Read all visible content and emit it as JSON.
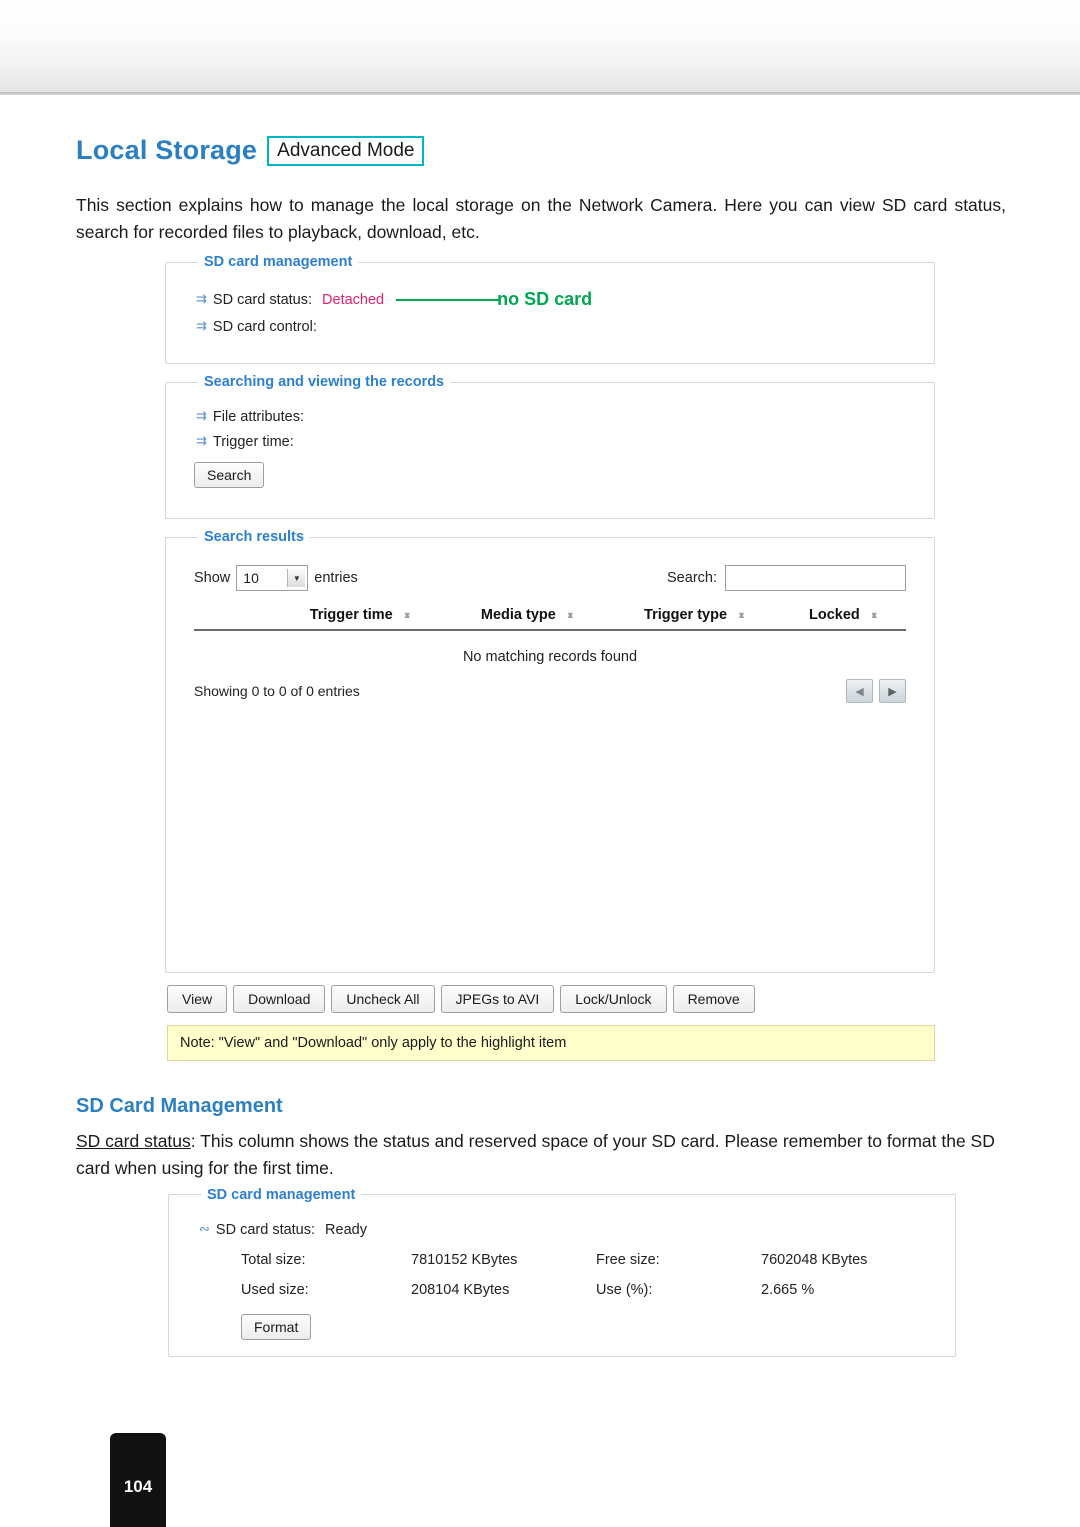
{
  "heading": {
    "title": "Local Storage",
    "badge": "Advanced Mode"
  },
  "intro": "This section explains how to manage the local storage on the Network Camera. Here you can view SD card status, search for recorded files to playback, download, etc.",
  "screenshot1": {
    "sd_management": {
      "legend": "SD card management",
      "status_label": "SD card status:",
      "status_value": "Detached",
      "callout": "no SD card",
      "control_label": "SD card control:"
    },
    "searching": {
      "legend": "Searching and viewing the records",
      "file_attributes_label": "File attributes:",
      "trigger_time_label": "Trigger time:",
      "search_button": "Search"
    },
    "results": {
      "legend": "Search results",
      "show_label": "Show",
      "show_value": "10",
      "entries_label": "entries",
      "search_label": "Search:",
      "search_value": "",
      "columns": [
        "",
        "Trigger time",
        "Media type",
        "Trigger type",
        "Locked"
      ],
      "empty_message": "No matching records found",
      "showing_text": "Showing 0 to 0 of 0 entries",
      "prev_icon": "prev-arrow-icon",
      "next_icon": "next-arrow-icon"
    },
    "buttons": [
      "View",
      "Download",
      "Uncheck All",
      "JPEGs to AVI",
      "Lock/Unlock",
      "Remove"
    ],
    "note": "Note: \"View\" and \"Download\" only apply to the highlight item"
  },
  "section2": {
    "heading": "SD Card Management",
    "para_underlined": "SD card status",
    "para_rest": ": This column shows the status and reserved space of your SD card. Please remember to format the SD card when using for the first time."
  },
  "screenshot2": {
    "legend": "SD card management",
    "status_label": "SD card status:",
    "status_value": "Ready",
    "fields": [
      {
        "label": "Total size:",
        "value": "7810152  KBytes"
      },
      {
        "label": "Free size:",
        "value": "7602048  KBytes"
      },
      {
        "label": "Used size:",
        "value": "208104  KBytes"
      },
      {
        "label": "Use (%):",
        "value": "2.665 %"
      }
    ],
    "format_button": "Format"
  },
  "footer": {
    "page_number": "104"
  }
}
